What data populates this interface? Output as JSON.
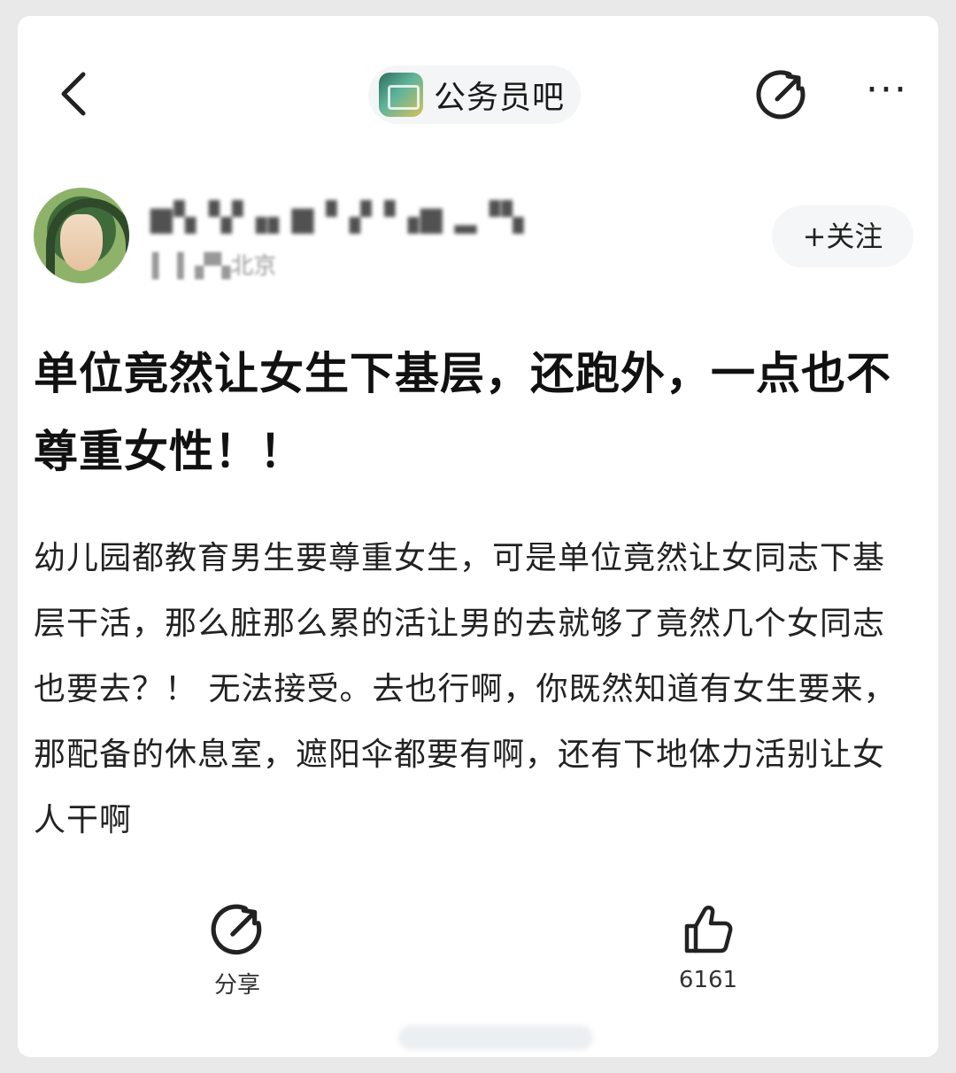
{
  "nav": {
    "forum_name": "公务员吧",
    "more_label": "···"
  },
  "author": {
    "name": "▆▚▝▞▗▖▆ ▘▞▝▗▆ ▂▝▚",
    "meta": "▍ ▍▞▚北京",
    "follow_label": "+关注"
  },
  "post": {
    "title": "单位竟然让女生下基层，还跑外，一点也不尊重女性！！",
    "body": "幼儿园都教育男生要尊重女生，可是单位竟然让女同志下基层干活，那么脏那么累的活让男的去就够了竟然几个女同志也要去？！ 无法接受。去也行啊，你既然知道有女生要来，那配备的休息室，遮阳伞都要有啊，还有下地体力活别让女人干啊"
  },
  "actions": {
    "share_label": "分享",
    "like_count": "6161"
  },
  "icons": [
    "back-arrow-icon",
    "forum-logo-icon",
    "share-icon",
    "more-icon",
    "like-icon"
  ]
}
